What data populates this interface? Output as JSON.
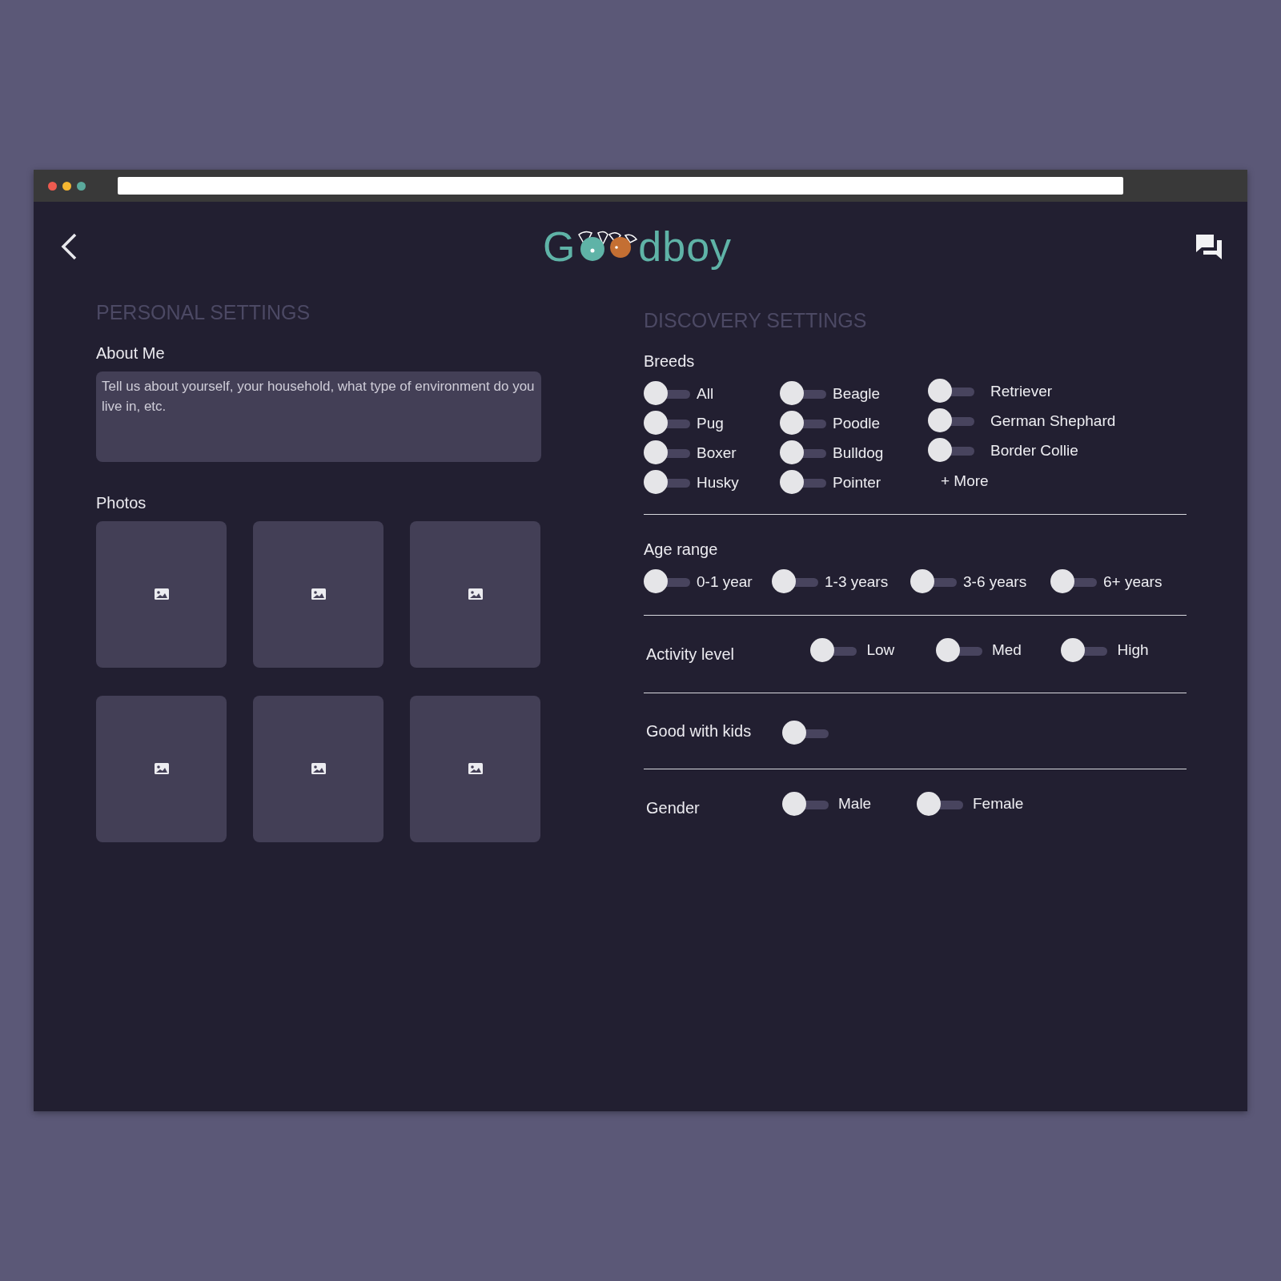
{
  "header": {
    "logo_start": "G",
    "logo_end": "dboy"
  },
  "personal": {
    "title": "PERSONAL SETTINGS",
    "about_label": "About Me",
    "about_placeholder": "Tell us about yourself, your household, what type of environment do you live in, etc.",
    "photos_label": "Photos",
    "photos": [
      {
        "kind": "empty"
      },
      {
        "kind": "empty"
      },
      {
        "kind": "empty"
      },
      {
        "kind": "empty"
      },
      {
        "kind": "empty"
      },
      {
        "kind": "empty"
      }
    ]
  },
  "discovery": {
    "title": "DISCOVERY SETTINGS",
    "breeds_label": "Breeds",
    "breed_columns": [
      [
        {
          "label": "All",
          "on": false
        },
        {
          "label": "Pug",
          "on": false
        },
        {
          "label": "Boxer",
          "on": false
        },
        {
          "label": "Husky",
          "on": false
        }
      ],
      [
        {
          "label": "Beagle",
          "on": false
        },
        {
          "label": "Poodle",
          "on": false
        },
        {
          "label": "Bulldog",
          "on": false
        },
        {
          "label": "Pointer",
          "on": false
        }
      ],
      [
        {
          "label": "Retriever",
          "on": false
        },
        {
          "label": "German Shephard",
          "on": false
        },
        {
          "label": "Border Collie",
          "on": false
        }
      ]
    ],
    "more_link": "+ More",
    "age_label": "Age range",
    "ages": [
      {
        "label": "0-1 year",
        "on": false
      },
      {
        "label": "1-3 years",
        "on": false
      },
      {
        "label": "3-6 years",
        "on": false
      },
      {
        "label": "6+ years",
        "on": false
      }
    ],
    "activity_label": "Activity level",
    "activity": [
      {
        "label": "Low",
        "on": false
      },
      {
        "label": "Med",
        "on": false
      },
      {
        "label": "High",
        "on": false
      }
    ],
    "kids_label": "Good with kids",
    "kids_on": false,
    "gender_label": "Gender",
    "genders": [
      {
        "label": "Male",
        "on": false
      },
      {
        "label": "Female",
        "on": false
      }
    ]
  }
}
